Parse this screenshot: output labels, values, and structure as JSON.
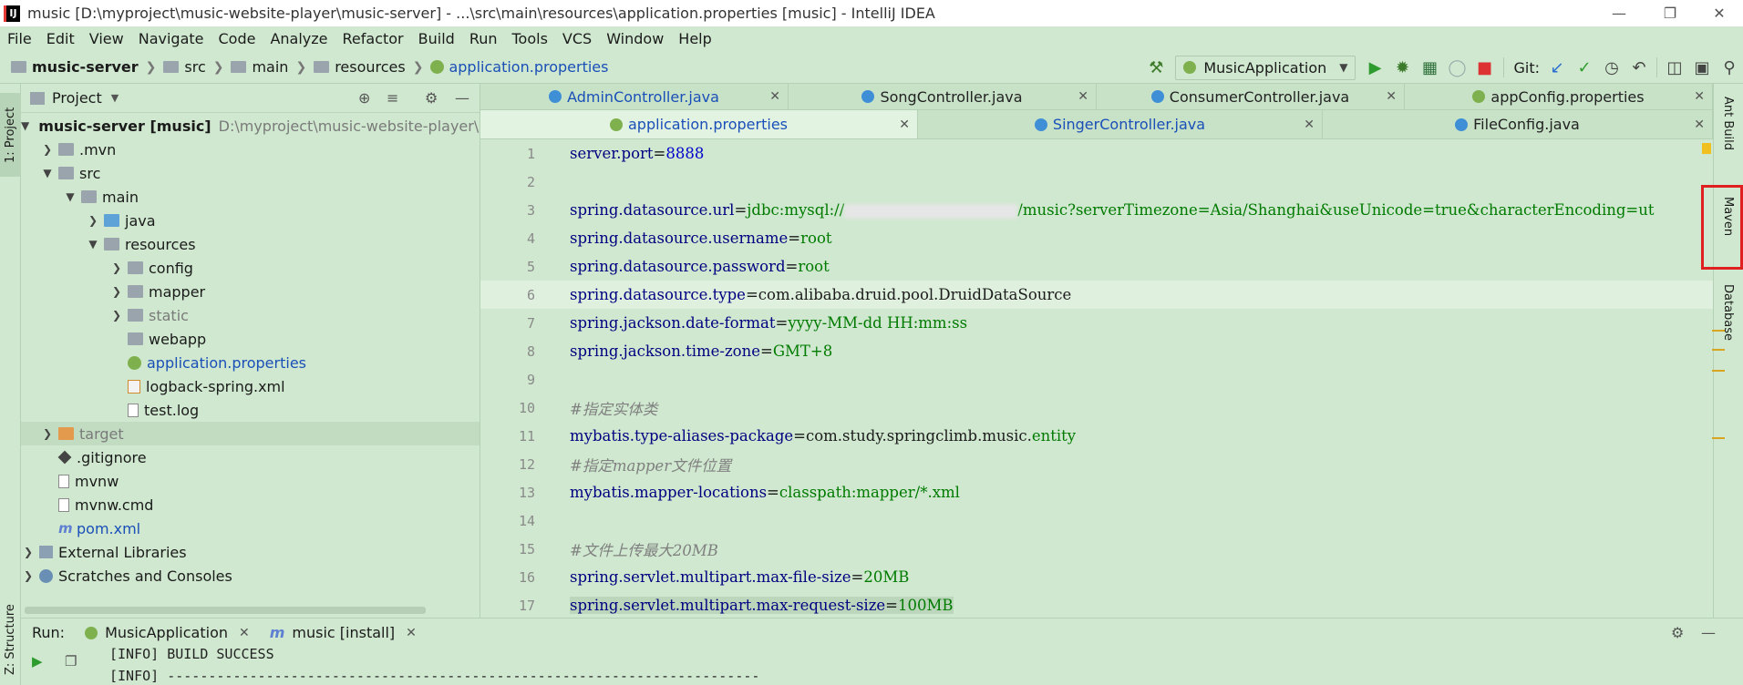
{
  "window": {
    "app_icon": "IJ",
    "title": "music [D:\\myproject\\music-website-player\\music-server] - ...\\src\\main\\resources\\application.properties [music] - IntelliJ IDEA",
    "controls": [
      "minimize-icon",
      "restore-icon",
      "close-icon"
    ]
  },
  "menu": {
    "items": [
      "File",
      "Edit",
      "View",
      "Navigate",
      "Code",
      "Analyze",
      "Refactor",
      "Build",
      "Run",
      "Tools",
      "VCS",
      "Window",
      "Help"
    ]
  },
  "breadcrumb": {
    "items": [
      "music-server",
      "src",
      "main",
      "resources",
      "application.properties"
    ]
  },
  "toolbar": {
    "run_config": "MusicApplication",
    "git_label": "Git:",
    "icons": [
      "hammer-icon",
      "run-icon",
      "debug-icon",
      "coverage-icon",
      "profile-icon",
      "stop-icon",
      "git-update-icon",
      "git-commit-icon",
      "history-icon",
      "revert-icon",
      "project-structure-icon",
      "layout-icon",
      "search-icon"
    ]
  },
  "left_strip": {
    "project_tab": "1: Project",
    "structure_tab": "Z: Structure"
  },
  "project_panel": {
    "title": "Project",
    "tree": [
      {
        "label": "music-server [music]",
        "path": "D:\\myproject\\music-website-player\\music-server",
        "depth": 0,
        "open": true,
        "icon": "folder-icon"
      },
      {
        "label": ".mvn",
        "depth": 1,
        "open": false,
        "icon": "folder-icon"
      },
      {
        "label": "src",
        "depth": 1,
        "open": true,
        "icon": "folder-icon"
      },
      {
        "label": "main",
        "depth": 2,
        "open": true,
        "icon": "folder-icon"
      },
      {
        "label": "java",
        "depth": 3,
        "open": false,
        "icon": "source-folder-icon"
      },
      {
        "label": "resources",
        "depth": 3,
        "open": true,
        "icon": "resources-folder-icon"
      },
      {
        "label": "config",
        "depth": 4,
        "open": false,
        "icon": "folder-icon"
      },
      {
        "label": "mapper",
        "depth": 4,
        "open": false,
        "icon": "folder-icon"
      },
      {
        "label": "static",
        "depth": 4,
        "open": false,
        "icon": "folder-icon"
      },
      {
        "label": "webapp",
        "depth": 4,
        "icon": "folder-icon"
      },
      {
        "label": "application.properties",
        "depth": 4,
        "icon": "properties-file-icon"
      },
      {
        "label": "logback-spring.xml",
        "depth": 4,
        "icon": "xml-file-icon"
      },
      {
        "label": "test.log",
        "depth": 4,
        "icon": "text-file-icon"
      },
      {
        "label": "target",
        "depth": 1,
        "open": false,
        "icon": "excluded-folder-icon"
      },
      {
        "label": ".gitignore",
        "depth": 1,
        "icon": "git-ignore-icon"
      },
      {
        "label": "mvnw",
        "depth": 1,
        "icon": "text-file-icon"
      },
      {
        "label": "mvnw.cmd",
        "depth": 1,
        "icon": "text-file-icon"
      },
      {
        "label": "pom.xml",
        "depth": 1,
        "icon": "maven-icon"
      },
      {
        "label": "External Libraries",
        "depth": 0,
        "open": false,
        "icon": "library-icon"
      },
      {
        "label": "Scratches and Consoles",
        "depth": 0,
        "open": false,
        "icon": "scratch-icon"
      }
    ]
  },
  "editor_tabs": {
    "row1": [
      "AdminController.java",
      "SongController.java",
      "ConsumerController.java",
      "appConfig.properties"
    ],
    "row2": [
      "application.properties",
      "SingerController.java",
      "FileConfig.java"
    ]
  },
  "editor": {
    "lines": [
      {
        "n": "1",
        "key": "server.port",
        "eq": "=",
        "val": "8888"
      },
      {
        "n": "2"
      },
      {
        "n": "3",
        "key": "spring.datasource.url",
        "eq": "=",
        "val": "jdbc:mysql://",
        "val2": "/music?serverTimezone=Asia/Shanghai&useUnicode=true&characterEncoding=ut"
      },
      {
        "n": "4",
        "key": "spring.datasource.username",
        "eq": "=",
        "val": "root"
      },
      {
        "n": "5",
        "key": "spring.datasource.password",
        "eq": "=",
        "val": "root"
      },
      {
        "n": "6",
        "key": "spring.datasource.type",
        "eq": "=",
        "val": "com.alibaba.druid.pool.DruidDataSource"
      },
      {
        "n": "7",
        "key": "spring.jackson.date-format",
        "eq": "=",
        "val": "yyyy-MM-dd HH:mm:ss"
      },
      {
        "n": "8",
        "key": "spring.jackson.time-zone",
        "eq": "=",
        "val": "GMT+8"
      },
      {
        "n": "9"
      },
      {
        "n": "10",
        "comment": "#指定实体类"
      },
      {
        "n": "11",
        "key": "mybatis.type-aliases-package",
        "eq": "=",
        "val": "com.study.springclimb.music.",
        "val2": "entity"
      },
      {
        "n": "12",
        "comment": "#指定mapper文件位置"
      },
      {
        "n": "13",
        "key": "mybatis.mapper-locations",
        "eq": "=",
        "val": "classpath:mapper/*.xml"
      },
      {
        "n": "14"
      },
      {
        "n": "15",
        "comment": "#文件上传最大20MB"
      },
      {
        "n": "16",
        "key": "spring.servlet.multipart.max-file-size",
        "eq": "=",
        "val": "20MB"
      },
      {
        "n": "17",
        "key": "spring.servlet.multipart.max-request-size",
        "eq": "=",
        "val": "100MB"
      }
    ]
  },
  "right_strip": {
    "tabs": [
      "Ant Build",
      "Maven",
      "Database"
    ]
  },
  "run_panel": {
    "label": "Run:",
    "tabs": [
      "MusicApplication",
      "music [install]"
    ],
    "console": [
      "[INFO] BUILD SUCCESS",
      "[INFO] ------------------------------------------------------------------------"
    ]
  }
}
